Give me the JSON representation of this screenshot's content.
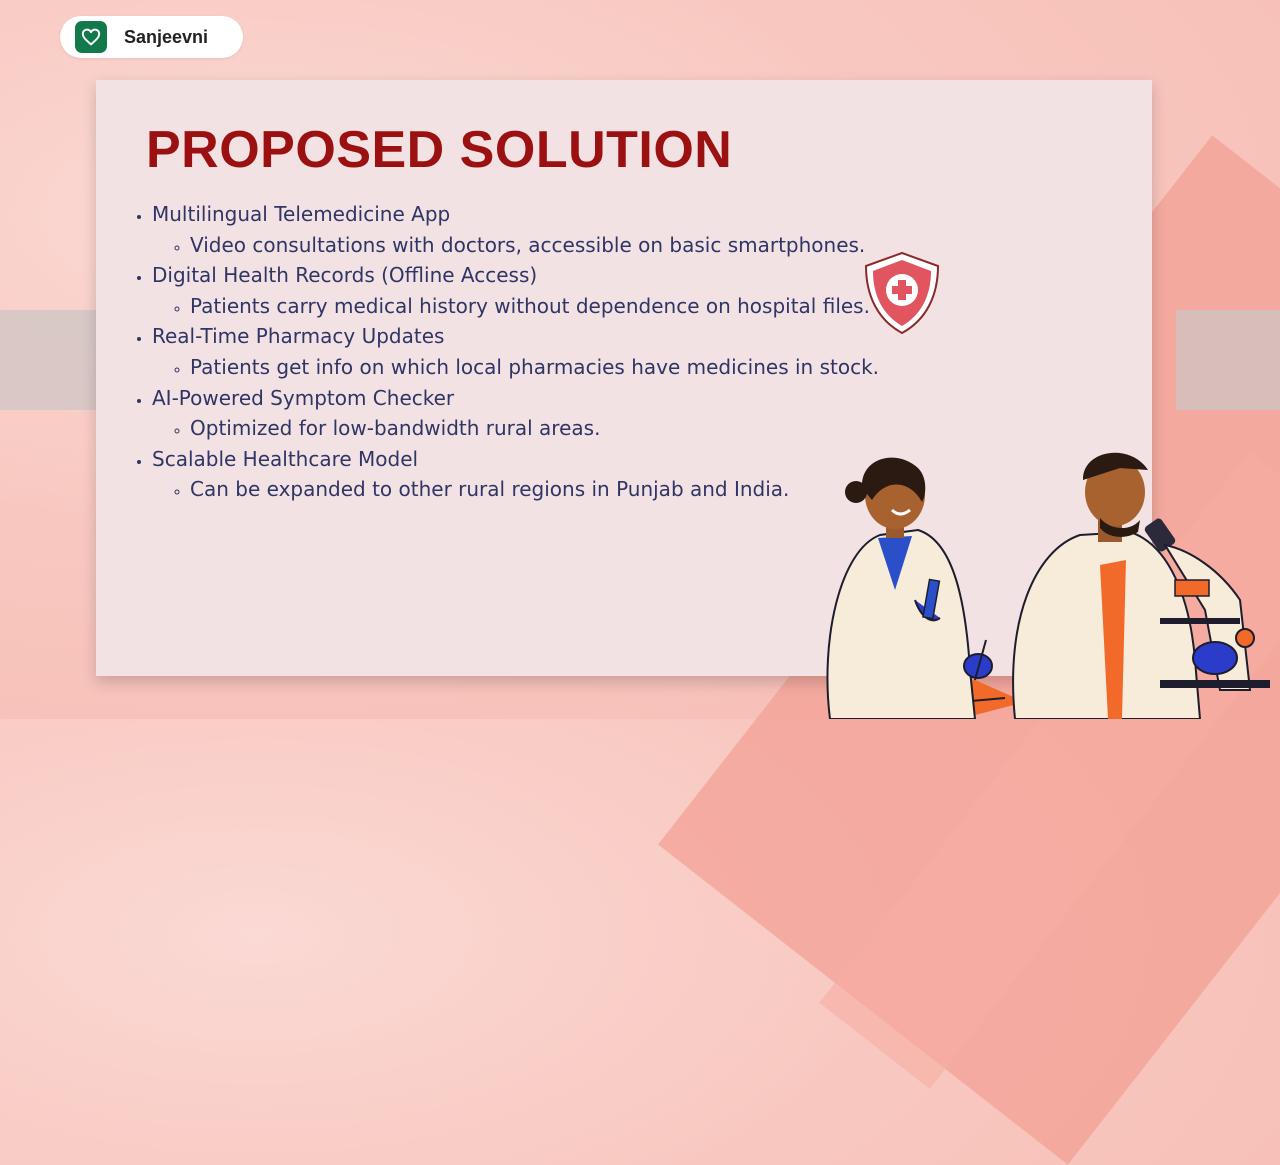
{
  "brand": {
    "name": "Sanjeevni",
    "icon": "heart-icon",
    "icon_color": "#127a4a"
  },
  "slide": {
    "title": "PROPOSED SOLUTION",
    "title_color": "#9b1111",
    "items": [
      {
        "label": "Multilingual Telemedicine App",
        "sub": "Video consultations with doctors, accessible on basic smartphones."
      },
      {
        "label": "Digital Health Records (Offline Access)",
        "sub": "Patients carry medical history without dependence on hospital files."
      },
      {
        "label": "Real-Time Pharmacy Updates",
        "sub": "Patients get info on which local pharmacies have medicines in stock."
      },
      {
        "label": "AI-Powered Symptom Checker",
        "sub": "Optimized for low-bandwidth rural areas."
      },
      {
        "label": "Scalable Healthcare Model",
        "sub": "Can be expanded to other rural regions in Punjab and India."
      }
    ]
  },
  "decor": {
    "shield_icon": "medical-shield-icon",
    "illustration": "doctors-illustration"
  }
}
